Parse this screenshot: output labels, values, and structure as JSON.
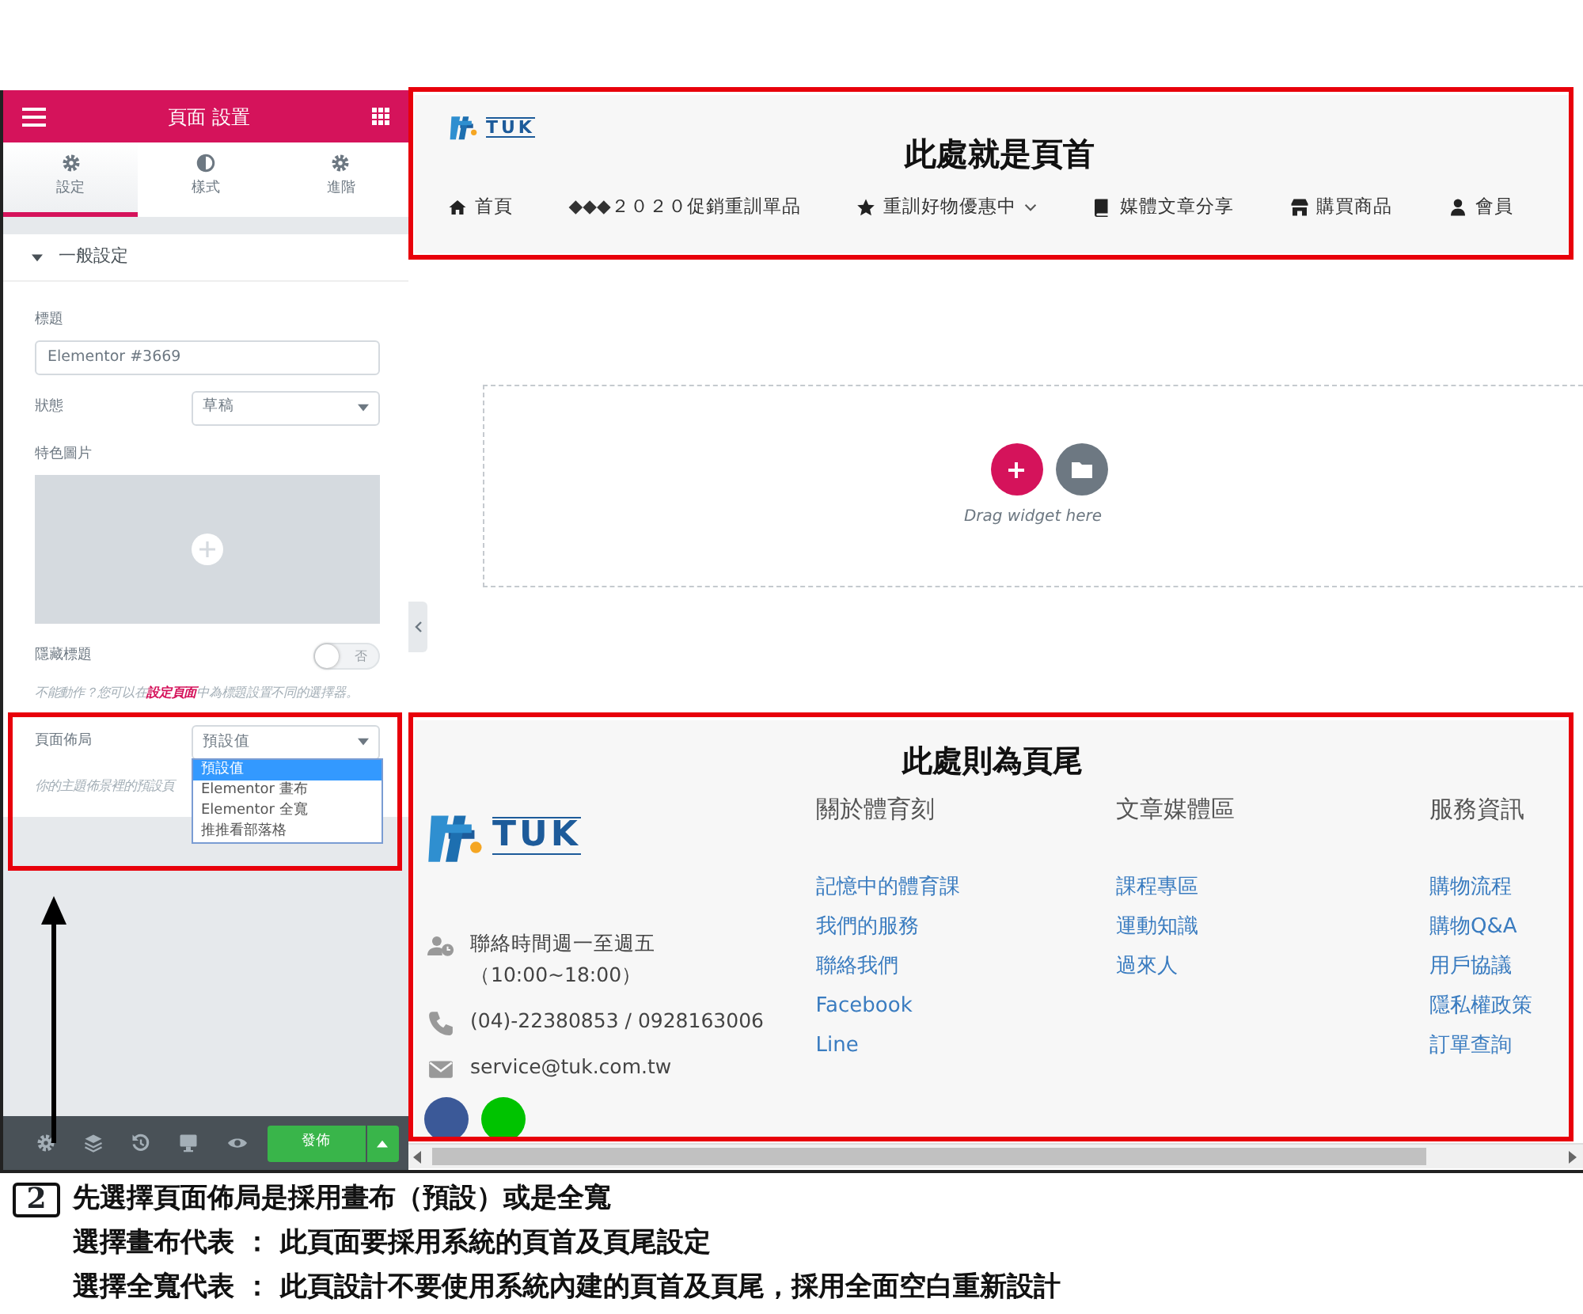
{
  "panel": {
    "title": "頁面 設置",
    "tabs": [
      {
        "label": "設定",
        "kind": "gear",
        "selected": true
      },
      {
        "label": "樣式",
        "kind": "contrast",
        "selected": false
      },
      {
        "label": "進階",
        "kind": "gear",
        "selected": false
      }
    ],
    "section": {
      "title": "一般設定",
      "expanded": true
    },
    "title_field": {
      "label": "標題",
      "value": "Elementor #3669"
    },
    "status_field": {
      "label": "狀態",
      "value": "草稿"
    },
    "featured_image": {
      "label": "特色圖片"
    },
    "hide_title": {
      "label": "隱藏標題",
      "on": false,
      "state_text": "否"
    },
    "hide_title_help": {
      "before": "不能動作？您可以在",
      "link": "設定頁面",
      "after": "中為標題設置不同的選擇器。"
    },
    "page_layout": {
      "label": "頁面佈局",
      "value": "預設值",
      "expanded": true,
      "help": "你的主題佈景裡的預設頁",
      "options": [
        {
          "label": "預設值",
          "selected": true
        },
        {
          "label": "Elementor 畫布",
          "selected": false
        },
        {
          "label": "Elementor 全寬",
          "selected": false
        },
        {
          "label": "推推看部落格",
          "selected": false
        }
      ]
    },
    "publish": "發佈"
  },
  "preview": {
    "header": {
      "logo": "TUK",
      "heading": "此處就是頁首",
      "nav": [
        {
          "label": "首頁",
          "kind": "home",
          "dropdown": false
        },
        {
          "label": "◆◆◆２０２０促銷重訓單品",
          "kind": "plain",
          "dropdown": false
        },
        {
          "label": "重訓好物優惠中",
          "kind": "star",
          "dropdown": true
        },
        {
          "label": "媒體文章分享",
          "kind": "book",
          "dropdown": false
        },
        {
          "label": "購買商品",
          "kind": "store",
          "dropdown": false
        },
        {
          "label": "會員",
          "kind": "user",
          "dropdown": false
        }
      ]
    },
    "dropzone": {
      "hint": "Drag widget here"
    },
    "footer": {
      "heading": "此處則為頁尾",
      "logo": "TUK",
      "contacts": [
        {
          "kind": "hours",
          "lines": [
            "聯絡時間週一至週五",
            "（10:00~18:00）"
          ]
        },
        {
          "kind": "phone",
          "lines": [
            "(04)-22380853 / 0928163006"
          ]
        },
        {
          "kind": "email",
          "lines": [
            "service@tuk.com.tw"
          ]
        }
      ],
      "columns": [
        {
          "heading": "關於體育刻",
          "links": [
            "記憶中的體育課",
            "我們的服務",
            "聯絡我們",
            "Facebook",
            "Line"
          ]
        },
        {
          "heading": "文章媒體區",
          "links": [
            "課程專區",
            "運動知識",
            "過來人"
          ]
        },
        {
          "heading": "服務資訊",
          "links": [
            "購物流程",
            "購物Q&A",
            "用戶協議",
            "隱私權政策",
            "訂單查詢"
          ]
        }
      ],
      "social": [
        {
          "kind": "facebook"
        },
        {
          "kind": "line"
        }
      ]
    }
  },
  "annotation": {
    "number": "2",
    "lines": [
      "先選擇頁面佈局是採用畫布（預設）或是全寬",
      "選擇畫布代表 ： 此頁面要採用系統的頁首及頁尾設定",
      "選擇全寬代表 ： 此頁設計不要使用系統內建的頁首及頁尾，採用全面空白重新設計"
    ]
  }
}
